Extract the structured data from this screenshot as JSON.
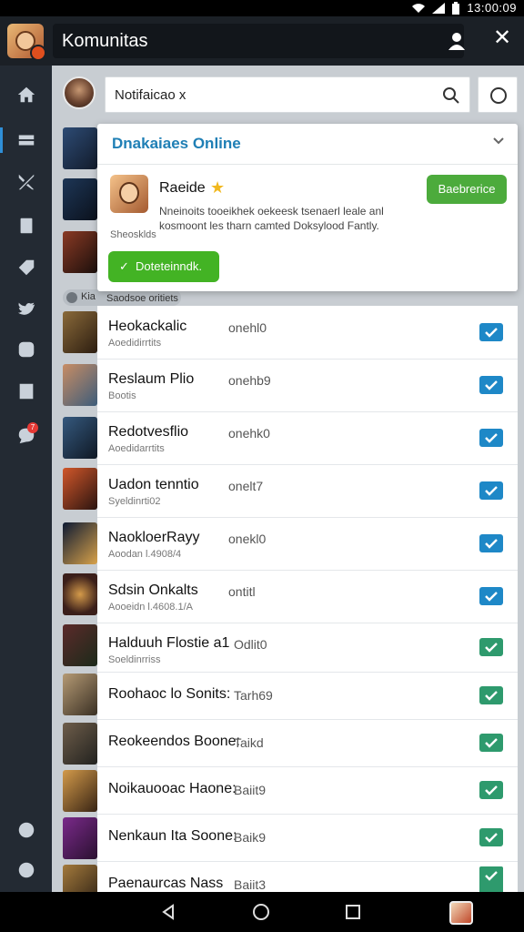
{
  "status_bar": {
    "time": "13:00:09"
  },
  "header": {
    "title": "Komunitas"
  },
  "search": {
    "query": "Notifaicao x"
  },
  "popup": {
    "title": "Dnakaiaes Online",
    "game_name": "Raeide",
    "description": "Nneinoits tooeikhek oekeesk tsenaerl leale anl kosmoont les tharn camted Doksylood Fantly.",
    "subtitle": "Sheosklds",
    "action_button": "Baebrerice",
    "done_button": "Doteteinndk."
  },
  "list_header": "Saodsoe oritiets",
  "list_header_prefix": "Kia",
  "colors": {
    "accent": "#1f7fb5",
    "check_blue": "#1e88c7",
    "check_teal": "#2e9a6d",
    "green": "#43b324"
  },
  "rows": [
    {
      "name": "Heokackalic",
      "code": "onehl0",
      "sub": "Aoedidirrtits",
      "check": "blue"
    },
    {
      "name": "Reslaum Plio",
      "code": "onehb9",
      "sub": "Bootis",
      "check": "blue"
    },
    {
      "name": "Redotvesflio",
      "code": "onehk0",
      "sub": "Aoedidarrtits",
      "check": "blue"
    },
    {
      "name": "Uadon tenntio",
      "code": "onelt7",
      "sub": "Syeldinrti02",
      "check": "blue"
    },
    {
      "name": "NaokloerRayy",
      "code": "onekl0",
      "sub": "Aoodan l.4908/4",
      "check": "blue"
    },
    {
      "name": "Sdsin Onkalts",
      "code": "ontitl",
      "sub": "Aooeidn l.4608.1/A",
      "check": "blue"
    },
    {
      "name": "Halduuh Flostie a1",
      "code": "Odlit0",
      "sub": "Soeldinrriss",
      "check": "teal"
    },
    {
      "name": "Roohaoc lo Sonits:",
      "code": "Tarh69",
      "sub": "",
      "check": "teal"
    },
    {
      "name": "Reokeendos Boone:",
      "code": "Taikd",
      "sub": "",
      "check": "teal"
    },
    {
      "name": "Noikauooac Haone:",
      "code": "Baiit9",
      "sub": "",
      "check": "teal"
    },
    {
      "name": "Nenkaun Ita Soone:",
      "code": "Baik9",
      "sub": "",
      "check": "teal"
    },
    {
      "name": "Paenaurcas Nass",
      "code": "Baiit3",
      "sub": "",
      "check": "teal-partial"
    }
  ]
}
